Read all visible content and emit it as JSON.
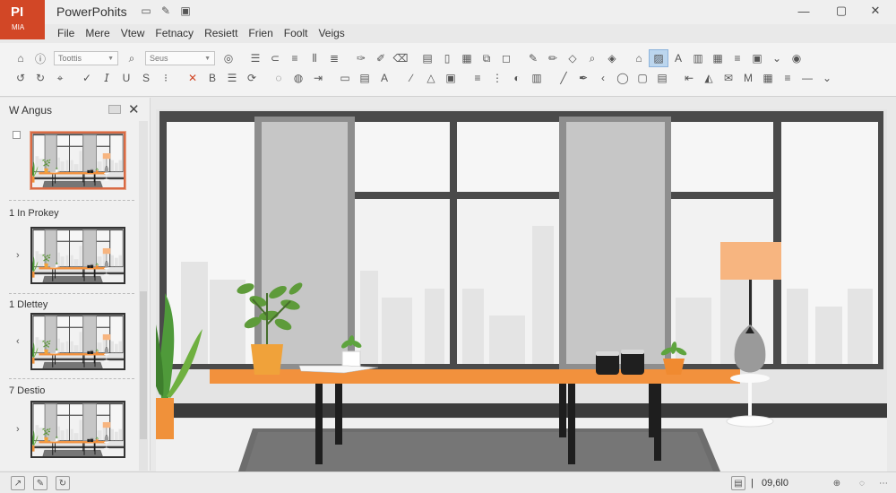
{
  "app": {
    "logo_top": "PI",
    "logo_bottom": "MIA",
    "title": "PowerPohits",
    "brand_color": "#d24726"
  },
  "titlebar": {
    "icons": [
      "minimize-small-icon",
      "edit-icon",
      "save-icon"
    ],
    "window_controls": [
      "minimize-icon",
      "maximize-icon",
      "close-icon"
    ]
  },
  "menu": [
    "File",
    "Mere",
    "Vtew",
    "Fetnacy",
    "Resiett",
    "Frien",
    "Foolt",
    "Veigs"
  ],
  "ribbon": {
    "font_select": "Toottis",
    "size_select": "Seus"
  },
  "panel": {
    "title": "W Angus",
    "sections": [
      {
        "label": "",
        "arrow": ""
      },
      {
        "label": "1  In Prokey",
        "arrow": "›"
      },
      {
        "label": "1  Dlettey",
        "arrow": "‹"
      },
      {
        "label": "7  Destio",
        "arrow": "›"
      }
    ]
  },
  "status": {
    "zoom": "09,6l0"
  },
  "colors": {
    "accent_select": "#d86a44",
    "table_top": "#f2913d",
    "lamp_shade": "#f7b580",
    "frame": "#4a4a4a"
  }
}
